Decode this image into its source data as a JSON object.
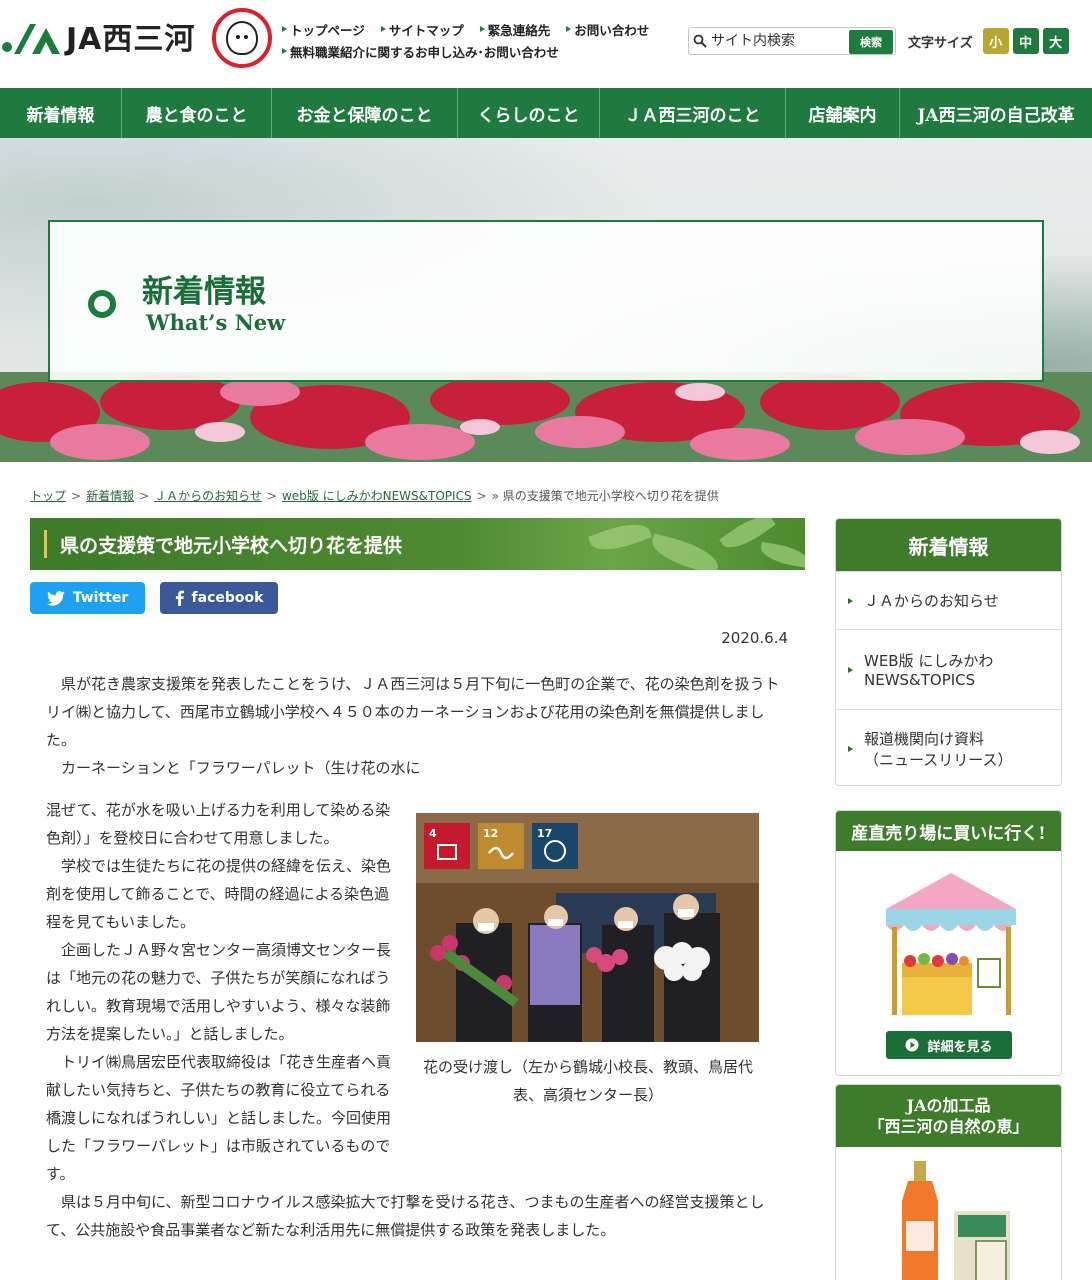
{
  "header": {
    "logo_text": "JA西三河",
    "links_row1": [
      "トップページ",
      "サイトマップ",
      "緊急連絡先",
      "お問い合わせ"
    ],
    "links_row2": [
      "無料職業紹介に関するお申し込み･お問い合わせ"
    ],
    "search_placeholder": "サイト内検索",
    "search_button": "検索",
    "font_size_label": "文字サイズ",
    "font_sizes": [
      "小",
      "中",
      "大"
    ],
    "colors": {
      "brand_green": "#1a7d3c",
      "font_small": "#b8a632",
      "font_mid": "#1e7a3e",
      "font_large": "#1e7a3e"
    }
  },
  "nav": {
    "items": [
      "新着情報",
      "農と食のこと",
      "お金と保障のこと",
      "くらしのこと",
      "ＪＡ西三河のこと",
      "店舗案内",
      "JA西三河の自己改革"
    ]
  },
  "hero": {
    "title_jp": "新着情報",
    "title_en": "What’s New"
  },
  "breadcrumb": {
    "links": [
      "トップ",
      "新着情報",
      "ＪＡからのお知らせ",
      "web版 にしみかわNEWS&TOPICS"
    ],
    "current": "» 県の支援策で地元小学校へ切り花を提供"
  },
  "article": {
    "title": "県の支援策で地元小学校へ切り花を提供",
    "share_twitter": "Twitter",
    "share_facebook": "facebook",
    "date": "2020.6.4",
    "para1": "　県が花き農家支援策を発表したことをうけ、ＪＡ西三河は５月下旬に一色町の企業で、花の染色剤を扱うトリイ㈱と協力して、西尾市立鶴城小学校へ４５０本のカーネーションおよび花用の染色剤を無償提供しました。",
    "para2": "　カーネーションと「フラワーパレット（生け花の水に",
    "para3": "混ぜて、花が水を吸い上げる力を利用して染める染色剤）」を登校日に合わせて用意しました。",
    "para4": "　学校では生徒たちに花の提供の経緯を伝え、染色剤を使用して飾ることで、時間の経過による染色過程を見てもいました。",
    "para5": "　企画したＪＡ野々宮センター高須博文センター長は「地元の花の魅力で、子供たちが笑顔になればうれしい。教育現場で活用しやすいよう、様々な装飾方法を提案したい。」と話しました。",
    "para6": "　トリイ㈱鳥居宏臣代表取締役は「花き生産者へ貢献したい気持ちと、子供たちの教育に役立てられる橋渡しになればうれしい」と話しました。今回使用した「フラワーパレット」は市販されているものです。",
    "para7": "　県は５月中旬に、新型コロナウイルス感染拡大で打撃を受ける花き、つまもの生産者への経営支援策として、公共施設や食品事業者など新たな利活用先に無償提供する政策を発表しました。",
    "caption": "花の受け渡し（左から鶴城小校長、教頭、鳥居代表、高須センター長）",
    "sdg_numbers": [
      "4",
      "12",
      "17"
    ]
  },
  "sidebar": {
    "news_title": "新着情報",
    "news_items": [
      {
        "line1": "ＪＡからのお知らせ",
        "line2": ""
      },
      {
        "line1": "WEB版 にしみかわ",
        "line2": "NEWS&TOPICS"
      },
      {
        "line1": "報道機関向け資料",
        "line2": "（ニュースリリース）"
      }
    ],
    "market_title": "産直売り場に買いに行く!",
    "market_button": "詳細を見る",
    "products_title_1": "JAの加工品",
    "products_title_2": "「西三河の自然の恵」"
  }
}
